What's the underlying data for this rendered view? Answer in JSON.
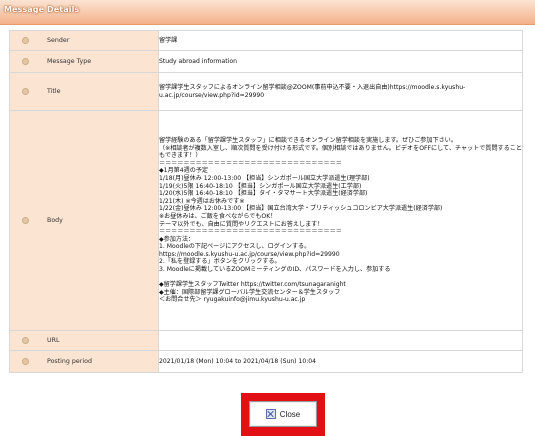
{
  "header": {
    "title": "Message Details"
  },
  "rows": {
    "sender": {
      "label": "Sender",
      "value": "留学課"
    },
    "type": {
      "label": "Message Type",
      "value": "Study abroad information"
    },
    "title": {
      "label": "Title",
      "value": "留学課学生スタッフによるオンライン留学相談@ZOOM(事前申込不要・入退出自由)https://moodle.s.kyushu-u.ac.jp/course/view.php?id=29990"
    },
    "body": {
      "label": "Body",
      "value": "留学経験のある「留学課学生スタッフ」に相談できるオンライン留学相談を実施します。ぜひご参加下さい。\n（※相談者が複数入室し、順次質問を受け付ける形式です。個別相談ではありません。ビデオをOFFにして、チャットで質問することもできます！）\n＝＝＝＝＝＝＝＝＝＝＝＝＝＝＝＝＝＝＝＝＝＝＝＝＝＝＝＝＝＝\n◆1月第4週の予定\n1/18(月)昼休み 12:00-13:00 【担当】シンガポール国立大学派遣生(理学部)\n1/19(火)5限 16:40-18:10 【担当】シンガポール国立大学派遣生(工学部)\n1/20(水)5限 16:40-18:10 【担当】タイ・タマサート大学派遣生(経済学部)\n1/21(木) ※今週はお休みです※\n1/22(金)昼休み 12:00-13:00 【担当】国立台湾大学・ブリティッシュコロンビア大学派遣生(経済学部)\n※お昼休みは、ご飯を食べながらでもOK！\nテーマ以外でも、自由に質問やリクエストにお答えします！\n＝＝＝＝＝＝＝＝＝＝＝＝＝＝＝＝＝＝＝＝＝＝＝＝＝＝＝＝＝＝\n◆参加方法：\n1. Moodleの下記ページにアクセスし、ログインする。\nhttps://moodle.s.kyushu-u.ac.jp/course/view.php?id=29990\n2.「私を登録する」ボタンをクリックする。\n3. Moodleに掲載しているZOOMミーティングのID、パスワードを入力し、参加する\n\n◆留学課学生スタッフTwitter https://twitter.com/tsunagaranight\n◆主催：国際部留学課グローバル学生交流センター＆学生スタッフ\n＜お問合せ先＞ ryugakuinfo@jimu.kyushu-u.ac.jp"
    },
    "url": {
      "label": "URL",
      "value": ""
    },
    "period": {
      "label": "Posting period",
      "value": "2021/01/18 (Mon) 10:04 to 2021/04/18 (Sun) 10:04"
    }
  },
  "close_button": {
    "label": "Close"
  }
}
